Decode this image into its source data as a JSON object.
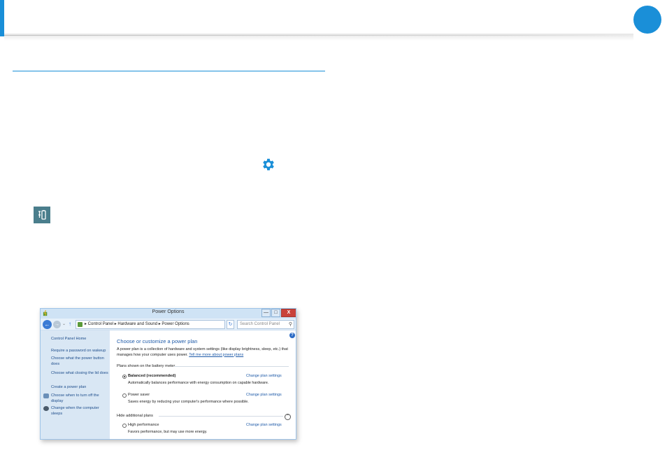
{
  "colors": {
    "accent": "#1a8fd8",
    "window_frame": "#cfe3f5",
    "sidebar_bg": "#d9e7f4",
    "link": "#1e5aa8",
    "close_button": "#c9423a"
  },
  "icons": {
    "settings": "gear-icon",
    "power_options": "battery-power-icon"
  },
  "window": {
    "title": "Power Options",
    "min_label": "—",
    "max_label": "□",
    "close_label": "X",
    "breadcrumb": "▸  Control Panel  ▸  Hardware and Sound  ▸  Power Options",
    "search_placeholder": "Search Control Panel",
    "sidebar": {
      "home": "Control Panel Home",
      "items": [
        "Require a password on wakeup",
        "Choose what the power button does",
        "Choose what closing the lid does",
        "Create a power plan",
        "Choose when to turn off the display",
        "Change when the computer sleeps"
      ]
    },
    "main": {
      "heading": "Choose or customize a power plan",
      "description": "A power plan is a collection of hardware and system settings (like display brightness, sleep, etc.) that manages how your computer uses power.",
      "description_link": "Tell me more about power plans",
      "group_battery": "Plans shown on the battery meter",
      "group_hidden": "Hide additional plans",
      "plans": [
        {
          "name": "Balanced (recommended)",
          "desc": "Automatically balances performance with energy consumption on capable hardware.",
          "link": "Change plan settings",
          "selected": true
        },
        {
          "name": "Power saver",
          "desc": "Saves energy by reducing your computer's performance where possible.",
          "link": "Change plan settings",
          "selected": false
        },
        {
          "name": "High performance",
          "desc": "Favors performance, but may use more energy.",
          "link": "Change plan settings",
          "selected": false
        }
      ]
    }
  }
}
